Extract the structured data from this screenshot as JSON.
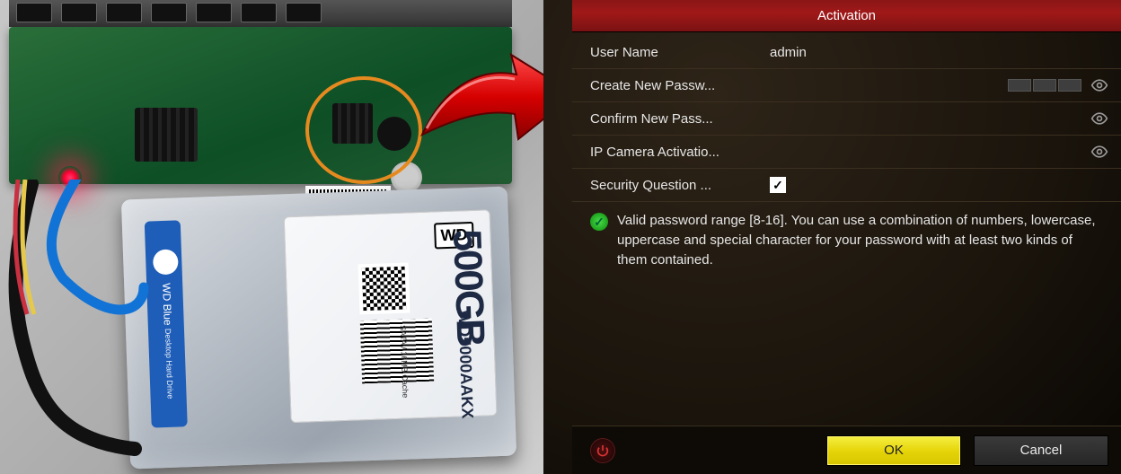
{
  "hardware": {
    "hdd_capacity": "500GB",
    "hdd_model": "WD5000AAKX",
    "hdd_series": "WD Blue",
    "hdd_series_sub": "Desktop Hard Drive",
    "hdd_brand": "WD",
    "hdd_interface": "SATA / 16MB Cache"
  },
  "dialog": {
    "title": "Activation",
    "rows": {
      "username_label": "User Name",
      "username_value": "admin",
      "create_pw_label": "Create New Passw...",
      "confirm_pw_label": "Confirm New Pass...",
      "ipcam_label": "IP Camera Activatio...",
      "secq_label": "Security Question ...",
      "secq_checked": "✓"
    },
    "hint": "Valid password range [8-16]. You can use a combination of numbers, lowercase, uppercase and special character for your password with at least two kinds of them contained.",
    "buttons": {
      "ok": "OK",
      "cancel": "Cancel"
    }
  }
}
